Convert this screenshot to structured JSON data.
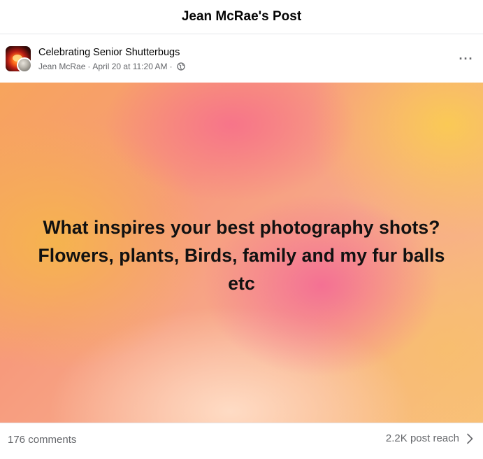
{
  "modal": {
    "title": "Jean McRae's Post"
  },
  "post": {
    "group_name": "Celebrating Senior Shutterbugs",
    "author": "Jean McRae",
    "separator": "·",
    "timestamp": "April 20 at 11:20 AM",
    "audience_icon": "globe-icon",
    "more_icon": "more-options-icon",
    "more_label": "···",
    "text_lines": [
      "What inspires your best photography shots?",
      "Flowers, plants, Birds, family and my fur balls",
      "etc"
    ],
    "background_colors": [
      "#f7a45c",
      "#f76e8c",
      "#f9c27a",
      "#ffdec8"
    ]
  },
  "footer": {
    "comments": "176 comments",
    "reach": "2.2K post reach",
    "reach_icon": "chevron-right-icon"
  }
}
